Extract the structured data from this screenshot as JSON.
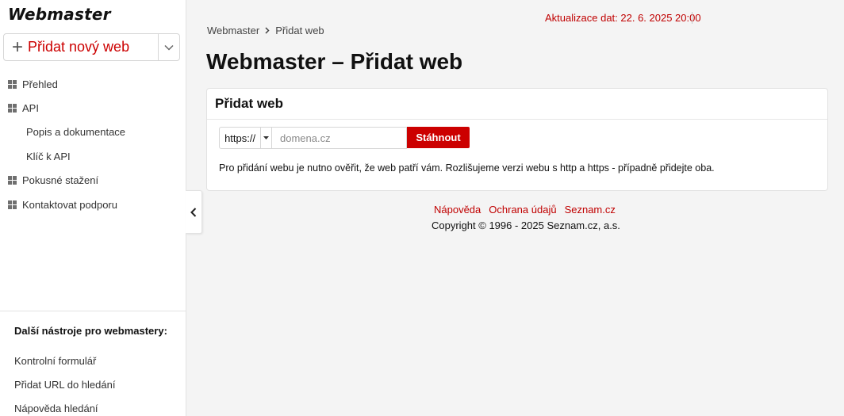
{
  "sidebar": {
    "logo": "Webmaster",
    "add_button": "Přidat nový web",
    "items": [
      {
        "label": "Přehled"
      },
      {
        "label": "API"
      },
      {
        "label": "Popis a dokumentace"
      },
      {
        "label": "Klíč k API"
      },
      {
        "label": "Pokusné stažení"
      },
      {
        "label": "Kontaktovat podporu"
      }
    ],
    "footer": {
      "heading": "Další nástroje pro webmastery:",
      "links": [
        "Kontrolní formulář",
        "Přidat URL do hledání",
        "Nápověda hledání"
      ]
    }
  },
  "header": {
    "update_text": "Aktualizace dat: 22. 6. 2025 20:00"
  },
  "breadcrumb": [
    "Webmaster",
    "Přidat web"
  ],
  "page_title": "Webmaster – Přidat web",
  "card": {
    "title": "Přidat web",
    "protocol": "https://",
    "domain_placeholder": "domena.cz",
    "submit": "Stáhnout",
    "info": "Pro přidání webu je nutno ověřit, že web patří vám. Rozlišujeme verzi webu s http a https - případně přidejte oba."
  },
  "footer": {
    "links": [
      "Nápověda",
      "Ochrana údajů",
      "Seznam.cz"
    ],
    "copyright": "Copyright © 1996 - 2025 Seznam.cz, a.s."
  },
  "colors": {
    "accent": "#cc0000",
    "background": "#f4f4f4"
  }
}
